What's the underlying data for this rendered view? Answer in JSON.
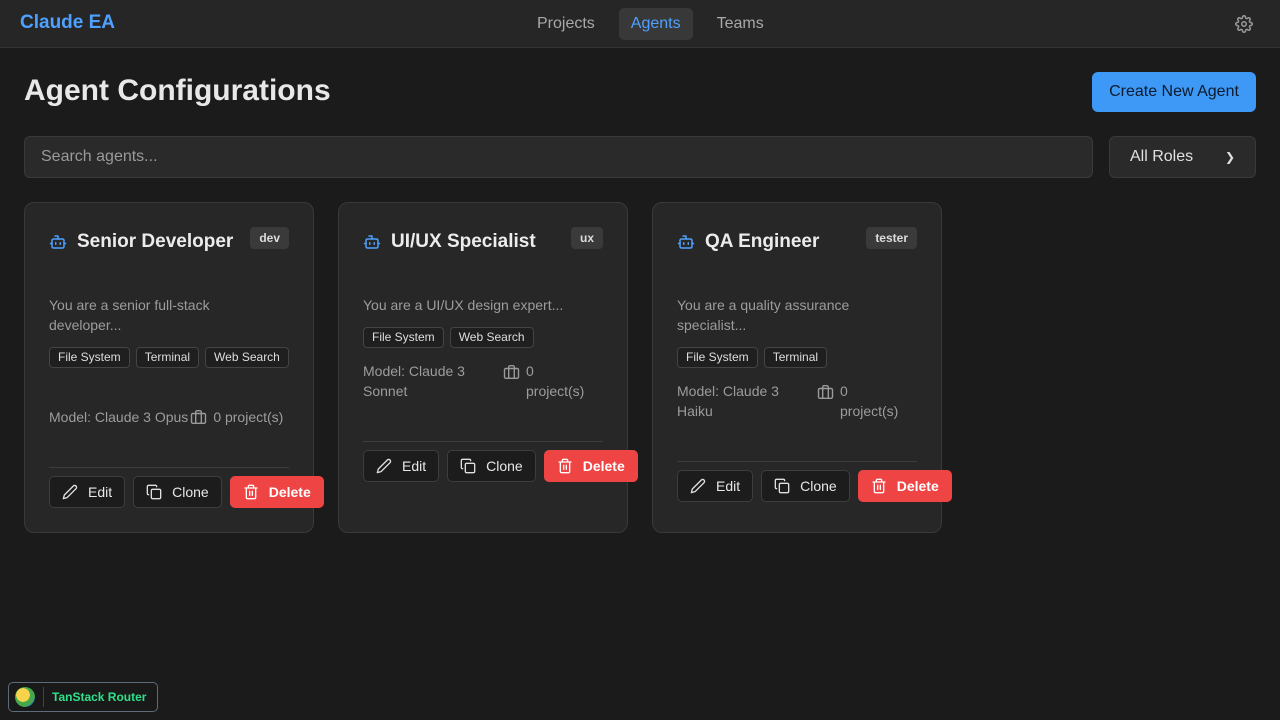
{
  "app": {
    "title": "Claude EA"
  },
  "nav": {
    "items": [
      {
        "label": "Projects",
        "active": false
      },
      {
        "label": "Agents",
        "active": true
      },
      {
        "label": "Teams",
        "active": false
      }
    ],
    "settings_icon": "gear-icon"
  },
  "page": {
    "title": "Agent Configurations",
    "create_label": "Create New Agent"
  },
  "search": {
    "placeholder": "Search agents...",
    "value": ""
  },
  "role_filter": {
    "selected": "All Roles"
  },
  "colors": {
    "accent": "#4ea1ff",
    "primary_button": "#3d99f5",
    "danger": "#ef4444",
    "devtools_text": "#2fe08a"
  },
  "agents": [
    {
      "name": "Senior Developer",
      "role": "dev",
      "description": "You are a senior full-stack developer...",
      "tools": [
        "File System",
        "Terminal",
        "Web Search"
      ],
      "model": "Model: Claude 3 Opus",
      "projects": "0 project(s)",
      "actions": {
        "edit": "Edit",
        "clone": "Clone",
        "delete": "Delete"
      }
    },
    {
      "name": "UI/UX Specialist",
      "role": "ux",
      "description": "You are a UI/UX design expert...",
      "tools": [
        "File System",
        "Web Search"
      ],
      "model": "Model: Claude 3 Sonnet",
      "projects": "0 project(s)",
      "actions": {
        "edit": "Edit",
        "clone": "Clone",
        "delete": "Delete"
      }
    },
    {
      "name": "QA Engineer",
      "role": "tester",
      "description": "You are a quality assurance specialist...",
      "tools": [
        "File System",
        "Terminal"
      ],
      "model": "Model: Claude 3 Haiku",
      "projects": "0 project(s)",
      "actions": {
        "edit": "Edit",
        "clone": "Clone",
        "delete": "Delete"
      }
    }
  ],
  "devtools": {
    "label": "TanStack Router"
  }
}
